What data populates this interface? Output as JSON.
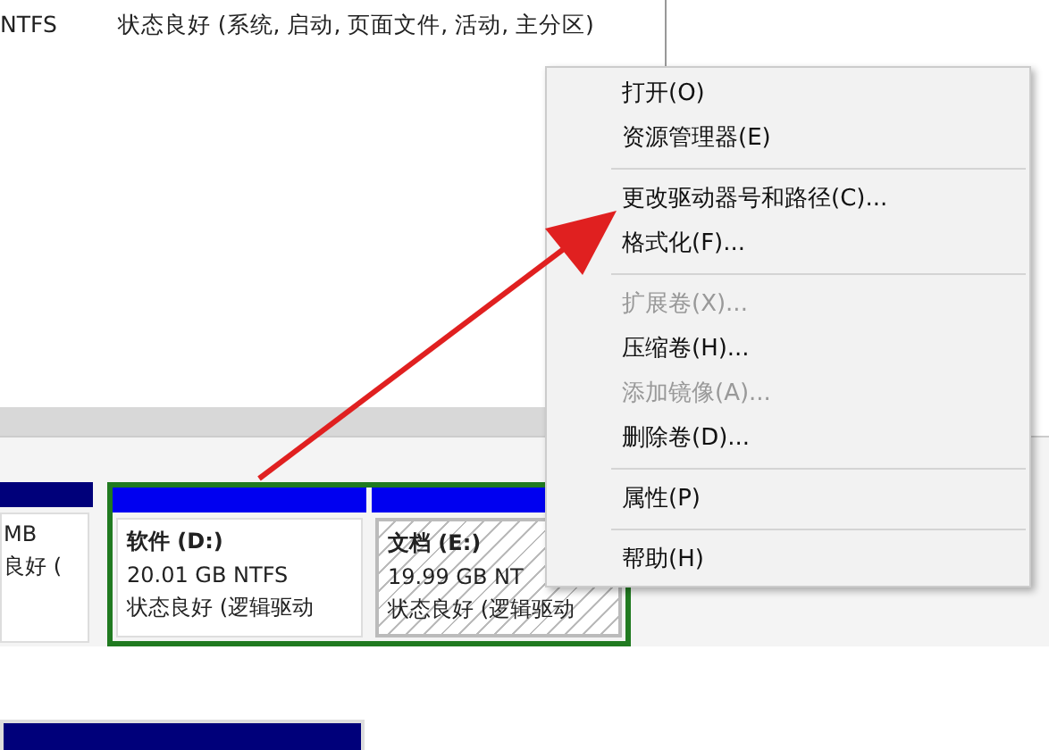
{
  "volume_list": {
    "rows": [
      {
        "file_system": "NTFS",
        "status": "状态良好 (系统, 启动, 页面文件, 活动, 主分区)"
      }
    ]
  },
  "disk_map": {
    "partitions": [
      {
        "kind": "primary",
        "selected": false,
        "size": "MB",
        "status": "良好 ("
      },
      {
        "kind": "logical",
        "selected": false,
        "name": "软件 (D:)",
        "size": "20.01 GB NTFS",
        "status": "状态良好 (逻辑驱动"
      },
      {
        "kind": "logical",
        "selected": true,
        "name": "文档 (E:)",
        "size": "19.99 GB NT",
        "status": "状态良好 (逻辑驱动"
      }
    ]
  },
  "context_menu": {
    "groups": [
      [
        {
          "label": "打开(O)",
          "disabled": false
        },
        {
          "label": "资源管理器(E)",
          "disabled": false
        }
      ],
      [
        {
          "label": "更改驱动器号和路径(C)...",
          "disabled": false
        },
        {
          "label": "格式化(F)...",
          "disabled": false
        }
      ],
      [
        {
          "label": "扩展卷(X)...",
          "disabled": true
        },
        {
          "label": "压缩卷(H)...",
          "disabled": false
        },
        {
          "label": "添加镜像(A)...",
          "disabled": true
        },
        {
          "label": "删除卷(D)...",
          "disabled": false
        }
      ],
      [
        {
          "label": "属性(P)",
          "disabled": false
        }
      ],
      [
        {
          "label": "帮助(H)",
          "disabled": false
        }
      ]
    ]
  }
}
